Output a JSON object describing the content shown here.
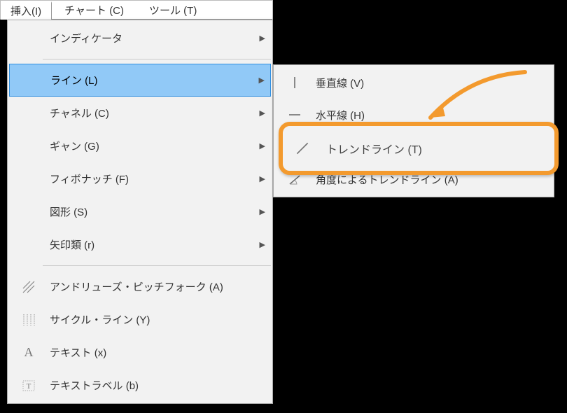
{
  "menubar": {
    "tabs": [
      {
        "label": "挿入(I)",
        "active": true
      },
      {
        "label": "チャート (C)",
        "active": false
      },
      {
        "label": "ツール (T)",
        "active": false
      }
    ]
  },
  "menu": {
    "items": [
      {
        "label": "インディケータ",
        "icon": null,
        "arrow": true
      },
      {
        "label": "ライン (L)",
        "icon": null,
        "arrow": true,
        "highlight": true
      },
      {
        "label": "チャネル (C)",
        "icon": null,
        "arrow": true
      },
      {
        "label": "ギャン (G)",
        "icon": null,
        "arrow": true
      },
      {
        "label": "フィボナッチ (F)",
        "icon": null,
        "arrow": true
      },
      {
        "label": "図形 (S)",
        "icon": null,
        "arrow": true
      },
      {
        "label": "矢印類 (r)",
        "icon": null,
        "arrow": true
      },
      {
        "label": "アンドリューズ・ピッチフォーク (A)",
        "icon": "pitchfork",
        "arrow": false
      },
      {
        "label": "サイクル・ライン (Y)",
        "icon": "cycle",
        "arrow": false
      },
      {
        "label": "テキスト (x)",
        "icon": "text",
        "arrow": false
      },
      {
        "label": "テキストラベル (b)",
        "icon": "text-label",
        "arrow": false
      }
    ]
  },
  "submenu": {
    "items": [
      {
        "label": "垂直線 (V)",
        "icon": "vertical-line"
      },
      {
        "label": "水平線 (H)",
        "icon": "horizontal-line"
      },
      {
        "label": "トレンドライン (T)",
        "icon": "trend-line",
        "callout": true
      },
      {
        "label": "角度によるトレンドライン (A)",
        "icon": "angle-trend-line"
      }
    ]
  },
  "colors": {
    "highlight_bg": "#91c9f7",
    "highlight_border": "#2f8fe0",
    "callout_border": "#f39a2e"
  }
}
